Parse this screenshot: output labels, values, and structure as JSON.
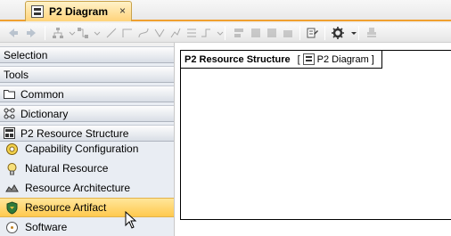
{
  "tab": {
    "label": "P2 Diagram",
    "close": "×"
  },
  "palette": {
    "sections": [
      {
        "label": "Selection"
      },
      {
        "label": "Tools"
      },
      {
        "label": "Common"
      },
      {
        "label": "Dictionary"
      },
      {
        "label": "P2 Resource Structure"
      }
    ],
    "items": [
      {
        "label": "Capability Configuration"
      },
      {
        "label": "Natural Resource"
      },
      {
        "label": "Resource Architecture"
      },
      {
        "label": "Resource Artifact"
      },
      {
        "label": "Software"
      }
    ]
  },
  "diagram": {
    "frame_title": "P2 Resource Structure",
    "open_bracket": "[",
    "frame_subtitle": "P2 Diagram ]"
  },
  "colors": {
    "accent": "#f0a030",
    "selected": "#ffd37a"
  }
}
